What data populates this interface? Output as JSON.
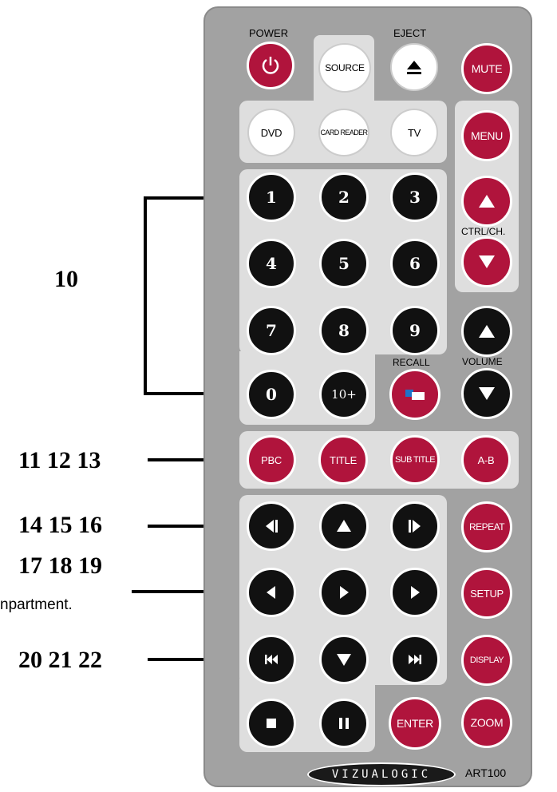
{
  "labels": {
    "power": "POWER",
    "eject": "EJECT",
    "ctrl_ch": "CTRL/CH.",
    "recall": "RECALL",
    "volume": "VOLUME"
  },
  "buttons": {
    "source": "SOURCE",
    "mute": "MUTE",
    "dvd": "DVD",
    "card_reader": "CARD READER",
    "tv": "TV",
    "menu": "MENU",
    "digits": [
      "1",
      "2",
      "3",
      "4",
      "5",
      "6",
      "7",
      "8",
      "9",
      "0",
      "10+"
    ],
    "pbc": "PBC",
    "title": "TITLE",
    "sub_title": "SUB TITLE",
    "ab": "A-B",
    "repeat": "REPEAT",
    "setup": "SETUP",
    "display": "DISPLAY",
    "enter": "ENTER",
    "zoom": "ZOOM"
  },
  "brand": {
    "logo": "VIZUALOGIC",
    "model": "ART100"
  },
  "annotations": {
    "n10": "10",
    "n11_13": "11 12 13",
    "n14_16": "14 15 16",
    "n17_19": "17 18 19",
    "n20_22": "20 21 22",
    "fragment": "npartment."
  },
  "colors": {
    "remote_body": "#a2a2a2",
    "panel": "#dedede",
    "red_button": "#b0143c",
    "black_button": "#111111"
  }
}
